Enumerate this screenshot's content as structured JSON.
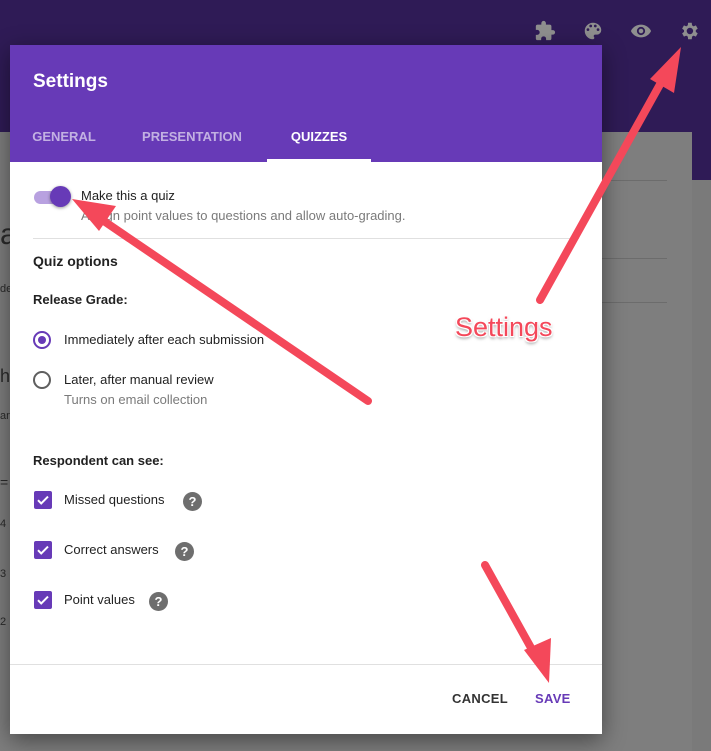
{
  "background": {
    "fragments": [
      "a",
      "de",
      "he",
      "an",
      "=",
      "4",
      "3",
      "2"
    ],
    "toolbar_icons": [
      "puzzle-icon",
      "palette-icon",
      "eye-icon",
      "gear-icon"
    ]
  },
  "dialog": {
    "title": "Settings",
    "tabs": [
      {
        "label": "GENERAL",
        "active": false
      },
      {
        "label": "PRESENTATION",
        "active": false
      },
      {
        "label": "QUIZZES",
        "active": true
      }
    ],
    "quiz_toggle": {
      "label": "Make this a quiz",
      "description": "Assign point values to questions and allow auto-grading.",
      "on": true
    },
    "quiz_options_heading": "Quiz options",
    "release_grade": {
      "heading": "Release Grade:",
      "options": [
        {
          "label": "Immediately after each submission",
          "checked": true
        },
        {
          "label": "Later, after manual review",
          "sub": "Turns on email collection",
          "checked": false
        }
      ]
    },
    "respondent_can_see": {
      "heading": "Respondent can see:",
      "items": [
        {
          "label": "Missed questions",
          "checked": true
        },
        {
          "label": "Correct answers",
          "checked": true
        },
        {
          "label": "Point values",
          "checked": true
        }
      ],
      "help_glyph": "?"
    },
    "footer": {
      "cancel_label": "CANCEL",
      "save_label": "SAVE"
    }
  },
  "annotation": {
    "text": "Settings",
    "color": "#f4485a"
  },
  "colors": {
    "accent": "#673ab7",
    "accent_light": "#b8a1e0",
    "topbar": "#2f1b56"
  }
}
